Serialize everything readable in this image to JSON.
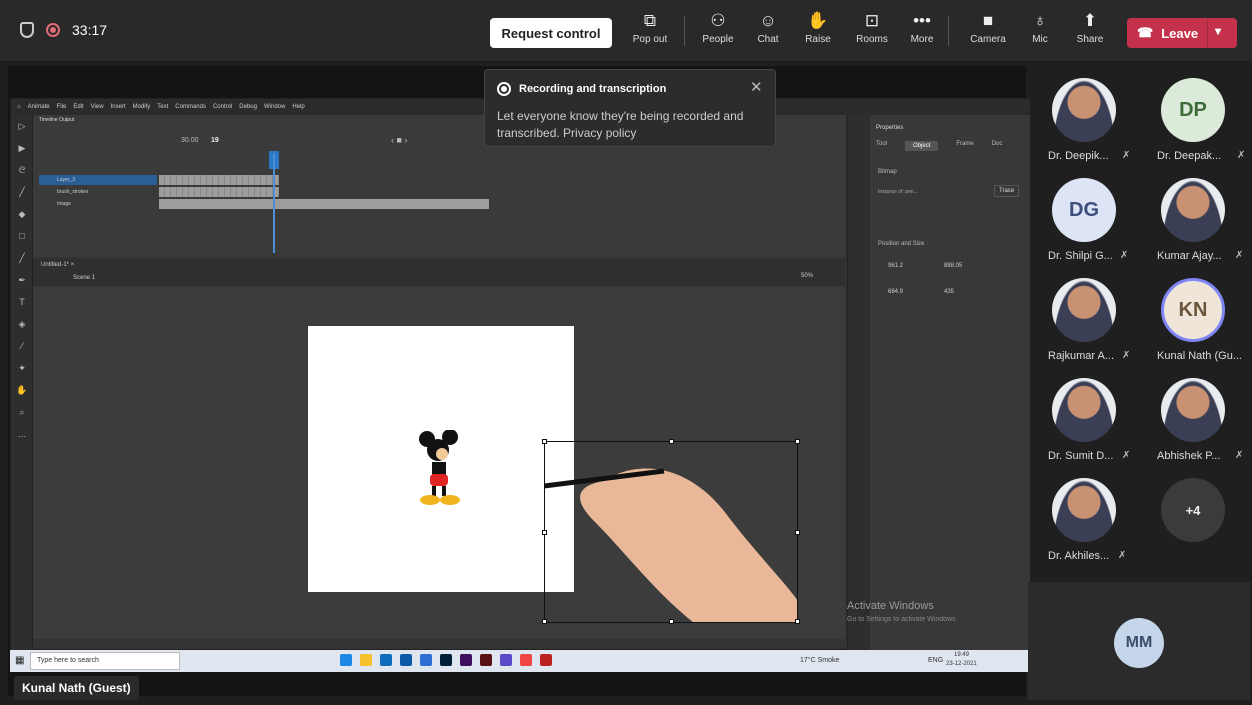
{
  "topbar": {
    "time": "33:17",
    "request_control": "Request control",
    "buttons": [
      {
        "label": "Pop out",
        "icon": "popout-icon"
      },
      {
        "label": "People",
        "icon": "people-icon"
      },
      {
        "label": "Chat",
        "icon": "chat-icon"
      },
      {
        "label": "Raise",
        "icon": "raise-hand-icon"
      },
      {
        "label": "Rooms",
        "icon": "rooms-icon"
      },
      {
        "label": "More",
        "icon": "more-icon"
      },
      {
        "label": "Camera",
        "icon": "camera-off-icon"
      },
      {
        "label": "Mic",
        "icon": "mic-off-icon"
      },
      {
        "label": "Share",
        "icon": "share-icon"
      }
    ],
    "leave": "Leave"
  },
  "notification": {
    "title": "Recording and transcription",
    "body": "Let everyone know they're being recorded and transcribed. Privacy policy"
  },
  "animate": {
    "app": "Animate",
    "menu": [
      "File",
      "Edit",
      "View",
      "Insert",
      "Modify",
      "Text",
      "Commands",
      "Control",
      "Debug",
      "Window",
      "Help"
    ],
    "timeline_tabs": "Timeline   Output",
    "fps": "30.00",
    "frame": "19",
    "layers": [
      "Layer_3",
      "brush_strokes",
      "Image"
    ],
    "doc_tab": "Untitled-1* ×",
    "scene": "Scene 1",
    "zoom": "50%",
    "properties": {
      "title": "Properties",
      "tabs": [
        "Tool",
        "Object",
        "Frame",
        "Doc"
      ],
      "bitmap": "Bitmap",
      "instance": "Instance of:  pen...",
      "trace": "Trace",
      "section": "Position and Size",
      "w": "961.2",
      "h": "684.9",
      "x": "888.05",
      "y": "435"
    }
  },
  "activate": {
    "title": "Activate Windows",
    "sub": "Go to Settings to activate Windows."
  },
  "taskbar": {
    "search": "Type here to search",
    "weather": "17°C Smoke",
    "lang": "ENG",
    "time": "19:49",
    "date": "23-12-2021"
  },
  "guest": "Kunal Nath (Guest)",
  "participants": [
    {
      "name": "Dr. Deepik...",
      "initials": "",
      "bg": "#e9ecef",
      "fg": "#333"
    },
    {
      "name": "Dr. Deepak...",
      "initials": "DP",
      "bg": "#dcebd9",
      "fg": "#3f6b3b"
    },
    {
      "name": "Dr. Shilpi G...",
      "initials": "DG",
      "bg": "#dde4f5",
      "fg": "#3f4f7d"
    },
    {
      "name": "Kumar Ajay...",
      "initials": "",
      "bg": "#e9ecef",
      "fg": "#333"
    },
    {
      "name": "Rajkumar A...",
      "initials": "",
      "bg": "#e9ecef",
      "fg": "#333"
    },
    {
      "name": "Kunal Nath (Gu...",
      "initials": "KN",
      "bg": "#efe6d9",
      "fg": "#6b553b"
    },
    {
      "name": "Dr. Sumit D...",
      "initials": "",
      "bg": "#e9ecef",
      "fg": "#333"
    },
    {
      "name": "Abhishek P...",
      "initials": "",
      "bg": "#e9ecef",
      "fg": "#333"
    },
    {
      "name": "Dr. Akhiles...",
      "initials": "",
      "bg": "#e9ecef",
      "fg": "#333"
    },
    {
      "name": "",
      "initials": "+4",
      "bg": "#3b3b3b",
      "fg": "#eee"
    }
  ],
  "mm": "MM"
}
